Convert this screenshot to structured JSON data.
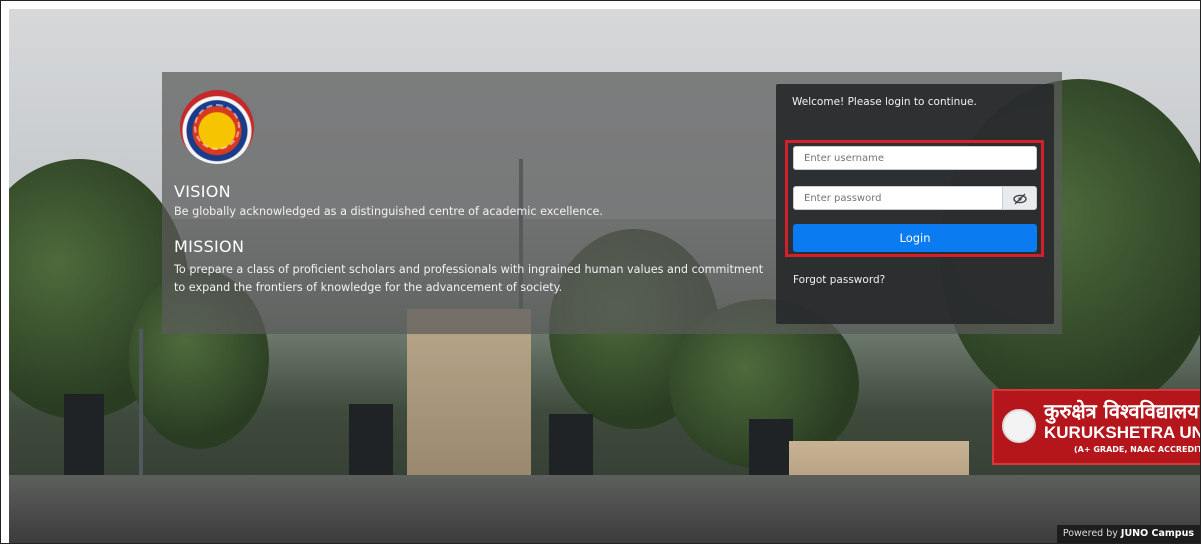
{
  "vision": {
    "title": "VISION",
    "text": "Be globally acknowledged as a distinguished centre of academic excellence."
  },
  "mission": {
    "title": "MISSION",
    "text": "To prepare a class of proficient scholars and professionals with ingrained human values and commitment to expand the frontiers of knowledge for the advancement of society."
  },
  "login": {
    "welcome": "Welcome! Please login to continue.",
    "username_placeholder": "Enter username",
    "password_placeholder": "Enter password",
    "toggle_icon": "eye-slash-icon",
    "button_label": "Login",
    "forgot_label": "Forgot password?"
  },
  "footer": {
    "powered_prefix": "Powered by",
    "powered_brand": "JUNO Campus"
  },
  "signboard": {
    "hindi": "कुरुक्षेत्र विश्वविद्यालय",
    "english": "KURUKSHETRA UNIVERSITY",
    "sub": "(A+ GRADE, NAAC ACCREDITED)"
  },
  "colors": {
    "login_button": "#0a7bf0",
    "highlight_border": "#d3212b",
    "signboard": "#b4161c"
  }
}
